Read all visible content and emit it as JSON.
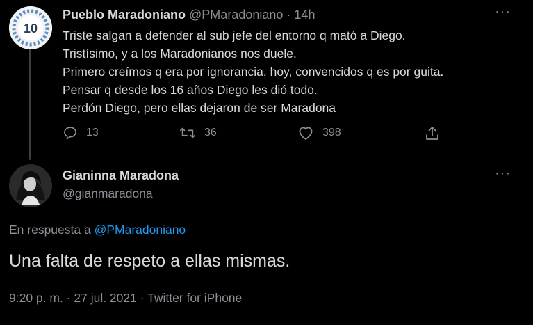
{
  "tweet1": {
    "display_name": "Pueblo Maradoniano",
    "handle": "@PMaradoniano",
    "separator": "·",
    "time": "14h",
    "avatar_text": "10",
    "lines": [
      "Triste salgan a defender al sub jefe del entorno q mató a Diego.",
      "Tristísimo, y a los Maradonianos nos duele.",
      "Primero creímos q era por ignorancia, hoy, convencidos q es por guita.",
      "Pensar q desde los 16 años Diego les dió todo.",
      "Perdón Diego, pero ellas dejaron de ser Maradona"
    ],
    "replies": "13",
    "retweets": "36",
    "likes": "398",
    "more": "···"
  },
  "tweet2": {
    "display_name": "Gianinna Maradona",
    "handle": "@gianmaradona",
    "more": "···",
    "reply_prefix": "En respuesta a ",
    "reply_mention": "@PMaradoniano",
    "text": "Una falta de respeto a ellas mismas.",
    "meta": "9:20 p. m. · 27 jul. 2021 · Twitter for iPhone"
  },
  "colors": {
    "background": "#000000",
    "text": "#d9d9d9",
    "muted": "#8b9096",
    "link": "#1d9bf0"
  }
}
